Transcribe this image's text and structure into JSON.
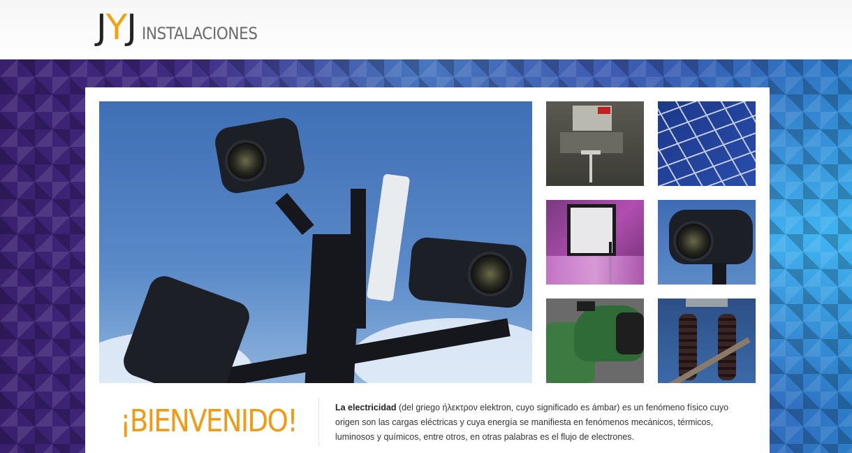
{
  "header": {
    "logo_mark_a": "J",
    "logo_mark_b": "Y",
    "logo_mark_c": "J",
    "logo_sub": "INSTALACIONES"
  },
  "hero": {
    "image": "security-cameras-photo"
  },
  "thumbnails": [
    {
      "image": "electrical-panel-thumbnail"
    },
    {
      "image": "solar-panel-thumbnail"
    },
    {
      "image": "presentation-screen-thumbnail"
    },
    {
      "image": "security-camera-thumbnail"
    },
    {
      "image": "water-pump-thumbnail"
    },
    {
      "image": "power-insulators-thumbnail"
    }
  ],
  "welcome": {
    "title": "¡BIENVENIDO!",
    "lead_bold": "La electricidad",
    "lead_rest": " (del griego ήλεκτρον elektron, cuyo significado es ámbar) es un fenómeno físico cuyo origen son las cargas eléctricas y cuya energía se manifiesta en fenómenos mecánicos, térmicos, luminosos y químicos, entre otros, en otras palabras es el flujo de electrones."
  },
  "colors": {
    "accent": "#f29a12",
    "logo_dark": "#222222",
    "logo_sub": "#6b6b6b"
  }
}
